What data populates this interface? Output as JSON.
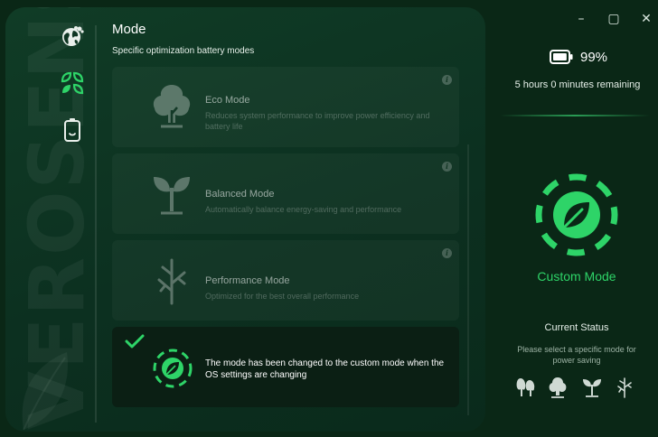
{
  "brand_watermark": "VEROSENSE",
  "header": {
    "title": "Mode",
    "subtitle": "Specific optimization battery modes"
  },
  "nav": [
    {
      "name": "globe",
      "icon": "eco-globe-icon",
      "active": false
    },
    {
      "name": "mode",
      "icon": "leaves-grid-icon",
      "active": true
    },
    {
      "name": "battery",
      "icon": "battery-icon",
      "active": false
    }
  ],
  "modes": [
    {
      "title": "Eco Mode",
      "description": "Reduces system performance to improve power efficiency and battery life",
      "icon": "tree-icon"
    },
    {
      "title": "Balanced Mode",
      "description": "Automatically balance energy-saving and performance",
      "icon": "sprout-icon"
    },
    {
      "title": "Performance Mode",
      "description": "Optimized for the best overall performance",
      "icon": "branch-icon"
    }
  ],
  "info_glyph": "i",
  "custom_card": {
    "message": "The mode has been changed to the custom mode when the OS settings are changing",
    "selected": true
  },
  "window_controls": {
    "minimize": "–",
    "maximize": "▢",
    "close": "✕"
  },
  "status_panel": {
    "battery_percent": "99%",
    "battery_level": 0.99,
    "remaining": "5 hours 0 minutes remaining",
    "active_mode": "Custom Mode",
    "current_status_label": "Current Status",
    "hint": "Please select a specific mode for power saving",
    "mode_icons": [
      "trees-icon",
      "tree-icon",
      "sprout-icon",
      "branch-icon"
    ]
  },
  "colors": {
    "accent": "#2ed468",
    "accent_dark": "#1fa54f",
    "panel_bg": "#0c3020",
    "app_bg": "#0a2716"
  }
}
